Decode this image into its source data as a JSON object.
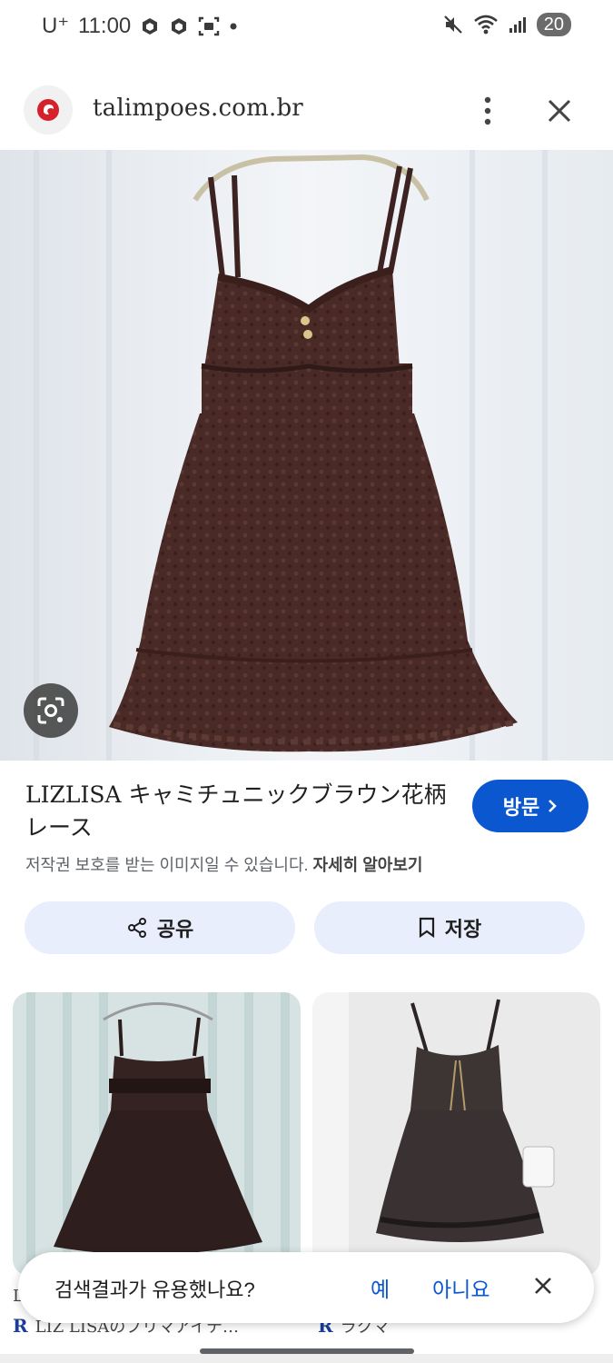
{
  "status_bar": {
    "carrier": "U⁺",
    "time": "11:00",
    "battery": "20",
    "icons": [
      "app-icon",
      "app-icon",
      "screenshot-icon",
      "dot-icon",
      "mute-icon",
      "wifi-icon",
      "signal-icon"
    ]
  },
  "browser": {
    "domain": "talimpoes.com.br",
    "icons": [
      "favicon-icon",
      "more-vert-icon",
      "close-icon"
    ]
  },
  "result": {
    "title": "LIZLISA キャミチュニックブラウン花柄レース",
    "visit_label": "방문",
    "copyright_notice": "저작권 보호를 받는 이미지일 수 있습니다.",
    "learn_more": "자세히 알아보기"
  },
  "actions": {
    "share_label": "공유",
    "save_label": "저장"
  },
  "related": [
    {
      "caption": "LIZ LISAのプリマアイテ…",
      "source_mark": "R",
      "prefix": "L"
    },
    {
      "caption": "ラクマ",
      "source_mark": "R"
    }
  ],
  "feedback": {
    "question": "검색결과가 유용했나요?",
    "yes": "예",
    "no": "아니요"
  },
  "colors": {
    "accent": "#0b57d0",
    "pill_bg": "#e8eefb",
    "dress_brown": "#4a2a26"
  }
}
